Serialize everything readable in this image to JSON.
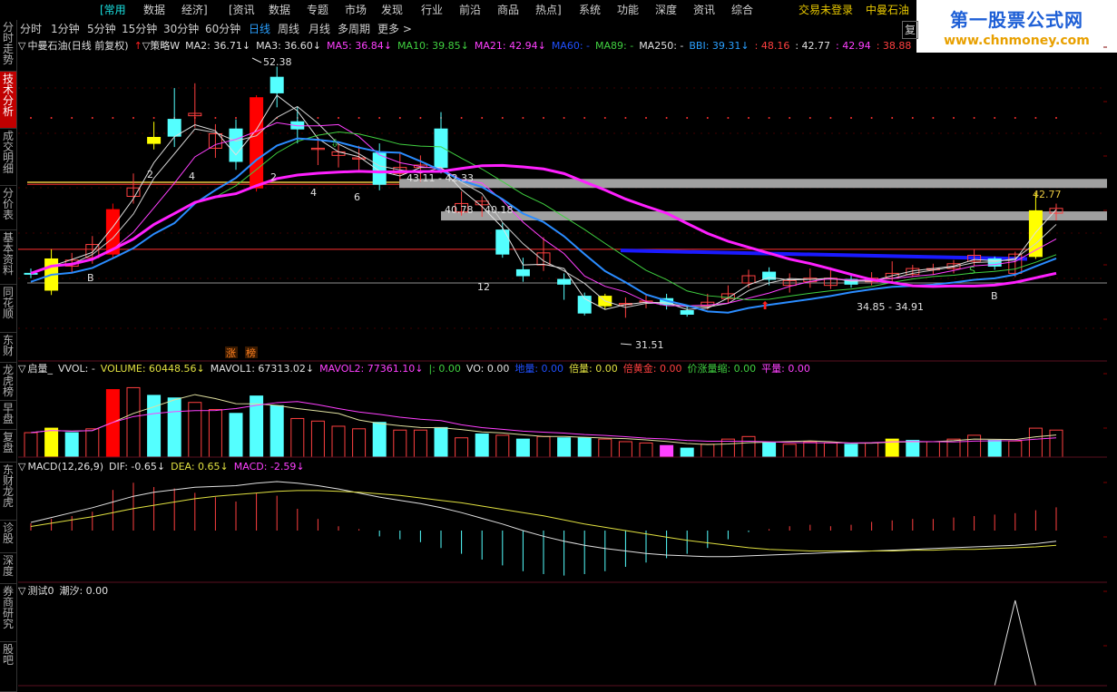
{
  "menu": {
    "items": [
      "[常用",
      "数据",
      "经济]",
      "[资讯",
      "数据",
      "专题",
      "市场",
      "发现",
      "行业",
      "前沿",
      "商品",
      "热点]",
      "系统",
      "功能",
      "深度",
      "资讯",
      "综合"
    ],
    "login": "交易未登录",
    "stock_name": "中曼石油"
  },
  "brand": {
    "line1": "第一股票公式网",
    "line2": "www.chnmoney.com"
  },
  "toolbar": {
    "items": [
      "分时",
      "1分钟",
      "5分钟",
      "15分钟",
      "30分钟",
      "60分钟",
      "日线",
      "周线",
      "月线",
      "多周期",
      "更多 >"
    ],
    "active_index": 6,
    "fuquan": "复"
  },
  "sidebar": {
    "items": [
      "分时走势",
      "技术分析",
      "成交明细",
      "分价表",
      "基本资料",
      "同花顺",
      "东财",
      "龙虎榜",
      "早盘",
      "复盘",
      "东财龙虎",
      "诊股",
      "深度",
      "券商研究",
      "股吧"
    ],
    "active_index": 1
  },
  "main_legend": {
    "title": "中曼石油(日线 前复权)",
    "strategy": "策略W",
    "items": [
      {
        "text": "MA2: 36.71↓",
        "color": "#e0e0e0"
      },
      {
        "text": "MA3: 36.60↓",
        "color": "#e0e0e0"
      },
      {
        "text": "MA5: 36.84↓",
        "color": "#ff40ff"
      },
      {
        "text": "MA10: 39.85↓",
        "color": "#40d040"
      },
      {
        "text": "MA21: 42.94↓",
        "color": "#ff40ff"
      },
      {
        "text": "MA60: -",
        "color": "#2050ff"
      },
      {
        "text": "MA89: -",
        "color": "#40d040"
      },
      {
        "text": "MA250: -",
        "color": "#e0e0e0"
      },
      {
        "text": "BBI: 39.31↓",
        "color": "#2aa0ff"
      },
      {
        "text": ": 48.16",
        "color": "#ff4040"
      },
      {
        "text": ": 42.77",
        "color": "#e0e0e0"
      },
      {
        "text": ": 42.94",
        "color": "#ff40ff"
      },
      {
        "text": ": 38.88",
        "color": "#ff4040"
      }
    ]
  },
  "volume_legend": {
    "title": "启量_",
    "items": [
      {
        "text": "VVOL: -",
        "color": "#e0e0e0"
      },
      {
        "text": "VOLUME: 60448.56↓",
        "color": "#e0e040"
      },
      {
        "text": "MAVOL1: 67313.02↓",
        "color": "#e0e0e0"
      },
      {
        "text": "MAVOL2: 77361.10↓",
        "color": "#ff40ff"
      },
      {
        "text": "|: 0.00",
        "color": "#40d040"
      },
      {
        "text": "VO: 0.00",
        "color": "#e0e0e0"
      },
      {
        "text": "地量: 0.00",
        "color": "#2050ff"
      },
      {
        "text": "倍量: 0.00",
        "color": "#e0e040"
      },
      {
        "text": "倍黄金: 0.00",
        "color": "#ff4040"
      },
      {
        "text": "价涨量缩: 0.00",
        "color": "#40d040"
      },
      {
        "text": "平量: 0.00",
        "color": "#ff40ff"
      }
    ]
  },
  "macd_legend": {
    "title": "MACD(12,26,9)",
    "items": [
      {
        "text": "DIF: -0.65↓",
        "color": "#e0e0e0"
      },
      {
        "text": "DEA: 0.65↓",
        "color": "#e0e040"
      },
      {
        "text": "MACD: -2.59↓",
        "color": "#ff40ff"
      }
    ]
  },
  "test_legend": {
    "title": "测试0",
    "items": [
      {
        "text": "潮汐: 0.00",
        "color": "#e0e0e0"
      }
    ]
  },
  "annotations": {
    "high": "52.38",
    "low": "31.51",
    "pair1": "43.11 - 42.33",
    "pair2a": "40.78",
    "pair2b": "40.18",
    "pair3": "34.85 - 34.91",
    "level": "42.77",
    "markers": [
      "2",
      "4",
      "2",
      "4",
      "6",
      "12",
      "B",
      "B",
      "S"
    ],
    "tags": [
      "涨",
      "榜"
    ]
  },
  "chart_data": {
    "type": "candlestick",
    "price_range": [
      29.5,
      54
    ],
    "candles": [
      {
        "o": 35.2,
        "c": 35.2,
        "h": 35.6,
        "l": 34.8,
        "u": 1
      },
      {
        "o": 33.8,
        "c": 36.4,
        "h": 37.2,
        "l": 33.4,
        "u": 3
      },
      {
        "o": 35.8,
        "c": 36.3,
        "h": 36.9,
        "l": 35.3,
        "u": 2
      },
      {
        "o": 36.5,
        "c": 37.6,
        "h": 38.3,
        "l": 36.0,
        "u": 2
      },
      {
        "o": 36.8,
        "c": 40.5,
        "h": 41.0,
        "l": 36.5,
        "u": 0
      },
      {
        "o": 41.6,
        "c": 42.3,
        "h": 43.5,
        "l": 41.0,
        "u": 2
      },
      {
        "o": 46.0,
        "c": 46.5,
        "h": 47.8,
        "l": 45.5,
        "u": 3
      },
      {
        "o": 48.0,
        "c": 46.6,
        "h": 50.6,
        "l": 45.7,
        "u": 1
      },
      {
        "o": 48.3,
        "c": 48.5,
        "h": 51.0,
        "l": 47.3,
        "u": 2
      },
      {
        "o": 46.8,
        "c": 45.6,
        "h": 47.6,
        "l": 44.8,
        "u": 2
      },
      {
        "o": 47.2,
        "c": 44.5,
        "h": 48.0,
        "l": 43.8,
        "u": 1
      },
      {
        "o": 42.3,
        "c": 49.8,
        "h": 50.0,
        "l": 42.0,
        "u": 0
      },
      {
        "o": 51.5,
        "c": 50.2,
        "h": 52.38,
        "l": 49.0,
        "u": 1
      },
      {
        "o": 47.8,
        "c": 47.2,
        "h": 49.0,
        "l": 46.0,
        "u": 1
      },
      {
        "o": 45.5,
        "c": 45.6,
        "h": 46.5,
        "l": 44.2,
        "u": 2
      },
      {
        "o": 45.3,
        "c": 45.0,
        "h": 46.0,
        "l": 44.0,
        "u": 2
      },
      {
        "o": 44.7,
        "c": 44.8,
        "h": 45.8,
        "l": 43.8,
        "u": 2
      },
      {
        "o": 45.2,
        "c": 42.6,
        "h": 46.0,
        "l": 42.1,
        "u": 1
      },
      {
        "o": 43.5,
        "c": 44.0,
        "h": 45.2,
        "l": 43.0,
        "u": 2
      },
      {
        "o": 44.2,
        "c": 44.0,
        "h": 45.0,
        "l": 42.8,
        "u": 2
      },
      {
        "o": 47.2,
        "c": 44.0,
        "h": 48.6,
        "l": 43.5,
        "u": 1
      },
      {
        "o": 41.0,
        "c": 40.3,
        "h": 42.0,
        "l": 40.0,
        "u": 2
      },
      {
        "o": 40.9,
        "c": 41.2,
        "h": 41.6,
        "l": 39.9,
        "u": 2
      },
      {
        "o": 38.8,
        "c": 36.8,
        "h": 39.4,
        "l": 36.5,
        "u": 1
      },
      {
        "o": 35.5,
        "c": 35.0,
        "h": 36.5,
        "l": 34.5,
        "u": 1
      },
      {
        "o": 35.9,
        "c": 36.9,
        "h": 38.2,
        "l": 35.4,
        "u": 2
      },
      {
        "o": 34.7,
        "c": 34.3,
        "h": 35.2,
        "l": 33.0,
        "u": 1
      },
      {
        "o": 33.3,
        "c": 31.9,
        "h": 33.6,
        "l": 31.7,
        "u": 1
      },
      {
        "o": 33.3,
        "c": 32.5,
        "h": 33.5,
        "l": 32.2,
        "u": 3
      },
      {
        "o": 32.6,
        "c": 32.7,
        "h": 33.2,
        "l": 31.51,
        "u": 2
      },
      {
        "o": 32.8,
        "c": 32.9,
        "h": 33.4,
        "l": 32.3,
        "u": 2
      },
      {
        "o": 33.1,
        "c": 32.6,
        "h": 33.5,
        "l": 32.2,
        "u": 1
      },
      {
        "o": 32.1,
        "c": 31.8,
        "h": 32.4,
        "l": 31.6,
        "u": 1
      },
      {
        "o": 32.5,
        "c": 32.8,
        "h": 33.5,
        "l": 32.2,
        "u": 2
      },
      {
        "o": 33.1,
        "c": 33.5,
        "h": 34.2,
        "l": 32.7,
        "u": 2
      },
      {
        "o": 34.4,
        "c": 35.0,
        "h": 35.5,
        "l": 34.0,
        "u": 2
      },
      {
        "o": 35.3,
        "c": 34.7,
        "h": 35.7,
        "l": 34.2,
        "u": 1
      },
      {
        "o": 34.2,
        "c": 34.6,
        "h": 35.2,
        "l": 33.6,
        "u": 2
      },
      {
        "o": 34.5,
        "c": 34.8,
        "h": 35.6,
        "l": 34.0,
        "u": 2
      },
      {
        "o": 34.2,
        "c": 34.8,
        "h": 35.7,
        "l": 33.9,
        "u": 2
      },
      {
        "o": 34.7,
        "c": 34.3,
        "h": 35.1,
        "l": 34.0,
        "u": 1
      },
      {
        "o": 34.5,
        "c": 34.8,
        "h": 35.3,
        "l": 34.2,
        "u": 2
      },
      {
        "o": 34.8,
        "c": 35.2,
        "h": 36.2,
        "l": 34.5,
        "u": 2
      },
      {
        "o": 35.1,
        "c": 35.6,
        "h": 35.9,
        "l": 34.9,
        "u": 2
      },
      {
        "o": 35.5,
        "c": 35.6,
        "h": 36.0,
        "l": 35.1,
        "u": 2
      },
      {
        "o": 35.6,
        "c": 36.0,
        "h": 36.3,
        "l": 35.2,
        "u": 2
      },
      {
        "o": 36.2,
        "c": 36.7,
        "h": 37.2,
        "l": 35.8,
        "u": 2
      },
      {
        "o": 36.4,
        "c": 35.8,
        "h": 36.6,
        "l": 35.5,
        "u": 1
      },
      {
        "o": 35.2,
        "c": 36.8,
        "h": 37.0,
        "l": 34.9,
        "u": 2
      },
      {
        "o": 36.6,
        "c": 40.4,
        "h": 41.9,
        "l": 36.4,
        "u": 3
      },
      {
        "o": 40.2,
        "c": 40.6,
        "h": 41.0,
        "l": 39.6,
        "u": 2
      }
    ],
    "volume": [
      {
        "v": 38,
        "u": 2
      },
      {
        "v": 45,
        "u": 3
      },
      {
        "v": 38,
        "u": 1
      },
      {
        "v": 44,
        "u": 2
      },
      {
        "v": 105,
        "u": 0
      },
      {
        "v": 108,
        "u": 2
      },
      {
        "v": 96,
        "u": 1
      },
      {
        "v": 92,
        "u": 1
      },
      {
        "v": 85,
        "u": 2
      },
      {
        "v": 74,
        "u": 2
      },
      {
        "v": 68,
        "u": 1
      },
      {
        "v": 95,
        "u": 1
      },
      {
        "v": 80,
        "u": 1
      },
      {
        "v": 60,
        "u": 2
      },
      {
        "v": 56,
        "u": 2
      },
      {
        "v": 48,
        "u": 2
      },
      {
        "v": 44,
        "u": 2
      },
      {
        "v": 54,
        "u": 1
      },
      {
        "v": 42,
        "u": 2
      },
      {
        "v": 42,
        "u": 2
      },
      {
        "v": 46,
        "u": 1
      },
      {
        "v": 30,
        "u": 2
      },
      {
        "v": 36,
        "u": 1
      },
      {
        "v": 34,
        "u": 2
      },
      {
        "v": 28,
        "u": 1
      },
      {
        "v": 32,
        "u": 2
      },
      {
        "v": 30,
        "u": 1
      },
      {
        "v": 30,
        "u": 1
      },
      {
        "v": 28,
        "u": 2
      },
      {
        "v": 24,
        "u": 2
      },
      {
        "v": 22,
        "u": 2
      },
      {
        "v": 18,
        "u": 4
      },
      {
        "v": 14,
        "u": 1
      },
      {
        "v": 20,
        "u": 2
      },
      {
        "v": 28,
        "u": 2
      },
      {
        "v": 32,
        "u": 2
      },
      {
        "v": 22,
        "u": 1
      },
      {
        "v": 20,
        "u": 2
      },
      {
        "v": 24,
        "u": 2
      },
      {
        "v": 22,
        "u": 2
      },
      {
        "v": 20,
        "u": 1
      },
      {
        "v": 22,
        "u": 2
      },
      {
        "v": 28,
        "u": 3
      },
      {
        "v": 26,
        "u": 1
      },
      {
        "v": 24,
        "u": 2
      },
      {
        "v": 28,
        "u": 2
      },
      {
        "v": 34,
        "u": 2
      },
      {
        "v": 26,
        "u": 1
      },
      {
        "v": 25,
        "u": 2
      },
      {
        "v": 45,
        "u": 2
      },
      {
        "v": 42,
        "u": 2
      }
    ],
    "macd": [
      0.5,
      0.8,
      1.0,
      1.3,
      2.8,
      3.3,
      3.0,
      2.9,
      2.6,
      2.3,
      2.0,
      2.6,
      2.4,
      1.5,
      0.8,
      0.3,
      0.1,
      -0.4,
      -0.6,
      -0.8,
      -1.2,
      -1.6,
      -2.0,
      -2.4,
      -2.8,
      -3.0,
      -3.1,
      -3.0,
      -2.8,
      -2.5,
      -2.2,
      -1.9,
      -1.6,
      -1.2,
      -0.6,
      -0.1,
      0.1,
      0.3,
      0.4,
      0.3,
      0.4,
      0.6,
      0.7,
      0.8,
      0.8,
      0.9,
      1.0,
      1.1,
      1.2,
      1.4,
      1.6
    ],
    "dif": [
      1.0,
      1.6,
      2.2,
      2.8,
      3.5,
      4.2,
      4.7,
      5.0,
      5.3,
      5.4,
      5.5,
      5.8,
      6.0,
      5.8,
      5.5,
      5.1,
      4.6,
      4.1,
      3.7,
      3.3,
      2.8,
      2.2,
      1.5,
      0.8,
      0.0,
      -0.7,
      -1.3,
      -1.8,
      -2.2,
      -2.5,
      -2.8,
      -3.0,
      -3.1,
      -3.2,
      -3.2,
      -3.1,
      -3.0,
      -2.9,
      -2.8,
      -2.7,
      -2.6,
      -2.5,
      -2.4,
      -2.3,
      -2.2,
      -2.1,
      -2.0,
      -1.9,
      -1.8,
      -1.6,
      -1.3
    ],
    "dea": [
      0.5,
      0.9,
      1.3,
      1.7,
      2.2,
      2.7,
      3.1,
      3.5,
      3.9,
      4.2,
      4.4,
      4.6,
      4.8,
      4.9,
      4.9,
      4.8,
      4.7,
      4.5,
      4.3,
      4.0,
      3.7,
      3.4,
      3.0,
      2.6,
      2.2,
      1.8,
      1.3,
      0.8,
      0.4,
      0.0,
      -0.4,
      -0.8,
      -1.2,
      -1.5,
      -1.8,
      -2.1,
      -2.3,
      -2.4,
      -2.5,
      -2.5,
      -2.5,
      -2.5,
      -2.5,
      -2.4,
      -2.4,
      -2.3,
      -2.3,
      -2.2,
      -2.1,
      -2.0,
      -1.8
    ],
    "tide": [
      0,
      0,
      0,
      0,
      0,
      0,
      0,
      0,
      0,
      0,
      0,
      0,
      0,
      0,
      0,
      0,
      0,
      0,
      0,
      0,
      0,
      0,
      0,
      0,
      0,
      0,
      0,
      0,
      0,
      0,
      0,
      0,
      0,
      0,
      0,
      0,
      0,
      0,
      0,
      0,
      0,
      0,
      0,
      0,
      0,
      0,
      0,
      0,
      1,
      0,
      0
    ]
  }
}
